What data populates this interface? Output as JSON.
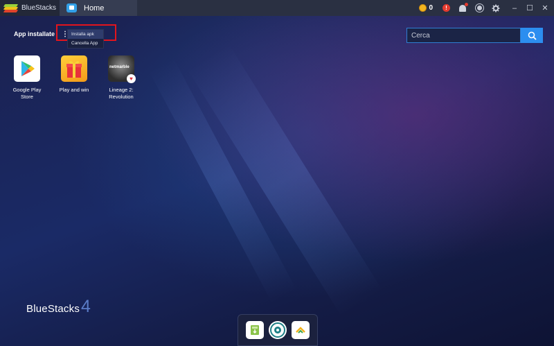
{
  "titlebar": {
    "app_name": "BlueStacks",
    "tab_label": "Home",
    "coins": "0",
    "alert_mark": "!",
    "controls": [
      "–",
      "☐",
      "✕"
    ]
  },
  "apps_section": {
    "title": "App installate",
    "menu": {
      "items": [
        "Installa apk",
        "Cancella App"
      ]
    }
  },
  "search": {
    "placeholder": "Cerca"
  },
  "apps": [
    {
      "label": "Google Play Store",
      "icon": "google-play-icon"
    },
    {
      "label": "Play and win",
      "icon": "gift-icon"
    },
    {
      "label": "Lineage 2: Revolution",
      "icon": "lineage-icon",
      "badge_text": "netmarble"
    }
  ],
  "footer_logo": {
    "text": "BlueStacks",
    "version": "4"
  },
  "dock": {
    "items": [
      {
        "icon": "apk-installer-icon"
      },
      {
        "icon": "camera-app-icon"
      },
      {
        "icon": "more-apps-icon"
      }
    ]
  },
  "colors": {
    "accent": "#2c8ef0",
    "highlight": "#e3141c",
    "titlebar": "#2a3042"
  }
}
